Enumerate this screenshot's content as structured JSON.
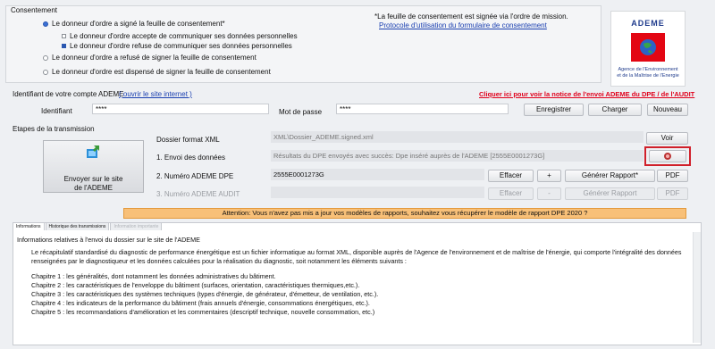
{
  "consent": {
    "title": "Consentement",
    "options": [
      {
        "label": "Le donneur d'ordre a signé la feuille de consentement*",
        "selected": true
      },
      {
        "label": "Le donneur d'ordre accepte de communiquer ses données personnelles",
        "selected": false
      },
      {
        "label": "Le donneur d'ordre refuse de communiquer ses données personnelles",
        "selected": true
      },
      {
        "label": "Le donneur d'ordre a refusé de signer la feuille de consentement",
        "selected": false
      },
      {
        "label": "Le donneur d'ordre est dispensé de signer la feuille de consentement",
        "selected": false
      }
    ],
    "note": "*La feuille de consentement est signée via l'ordre de mission.",
    "protocol_link": "Protocole d'utilisation du formulaire de consentement"
  },
  "logo": {
    "name": "ADEME",
    "line1": "Agence de l'Environnement",
    "line2": "et de la Maîtrise de l'Energie",
    "brand_color": "#e30613"
  },
  "account": {
    "label": "Identifiant de votre compte ADEME",
    "open_site_link": "( ouvrir le site internet )",
    "notice_link": "Cliquer ici pour voir la notice de l'envoi ADEME du DPE / de l'AUDIT",
    "identifiant_label": "Identifiant",
    "identifiant_value": "****",
    "password_label": "Mot de passe",
    "password_value": "****",
    "buttons": {
      "save": "Enregistrer",
      "load": "Charger",
      "new": "Nouveau"
    }
  },
  "transmission": {
    "title": "Etapes de la transmission",
    "send_button": {
      "line1": "Envoyer sur le site",
      "line2": "de l'ADEME",
      "icon": "upload-icon"
    },
    "xml_label": "Dossier format XML",
    "xml_value": "XML\\Dossier_ADEME.signed.xml",
    "voir": "Voir",
    "step1_label": "1. Envoi des données",
    "step1_value": "Résultats du DPE envoyés avec succès: Dpe inséré auprès de l'ADEME [2555E0001273G]",
    "step2_label": "2. Numéro ADEME DPE",
    "step2_value": "2555E0001273G",
    "step3_label": "3. Numéro ADEME AUDIT",
    "step3_value": "",
    "effacer": "Effacer",
    "plus": "+",
    "minus": "-",
    "generer": "Générer Rapport*",
    "generer_dis": "Générer Rapport",
    "pdf": "PDF",
    "highlight_color": "#d0202a"
  },
  "warning": "Attention: Vous n'avez pas mis a jour vos modèles de rapports, souhaitez vous récupérer le modèle de rapport DPE 2020 ?",
  "tabs": [
    "Informations",
    "Historique des transmissions",
    "Information importante"
  ],
  "info": {
    "heading": "Informations relatives à l'envoi du dossier sur le site de l'ADEME",
    "para": "Le récapitulatif standardisé du diagnostic de performance énergétique est un fichier informatique au format XML, disponible auprès de l'Agence de l'environnement et de maîtrise de l'énergie, qui comporte l'intégralité des données renseignées par le diagnostiqueur et les données calculées pour la réalisation du diagnostic, soit notamment les éléments suivants :",
    "chapters": [
      "Chapitre 1 : les généralités, dont notamment les données administratives du bâtiment.",
      "Chapitre 2 : les caractéristiques de l'enveloppe du bâtiment (surfaces, orientation, caractéristiques thermiques,etc.).",
      "Chapitre 3 : les caractéristiques des systèmes techniques (types d'énergie, de générateur, d'émetteur, de ventilation, etc.).",
      "Chapitre 4 : les indicateurs de la performance du bâtiment (frais annuels d'énergie, consommations énergétiques, etc.).",
      "Chapitre 5 : les recommandations d'amélioration et les commentaires (descriptif technique, nouvelle consommation,  etc.)"
    ]
  }
}
